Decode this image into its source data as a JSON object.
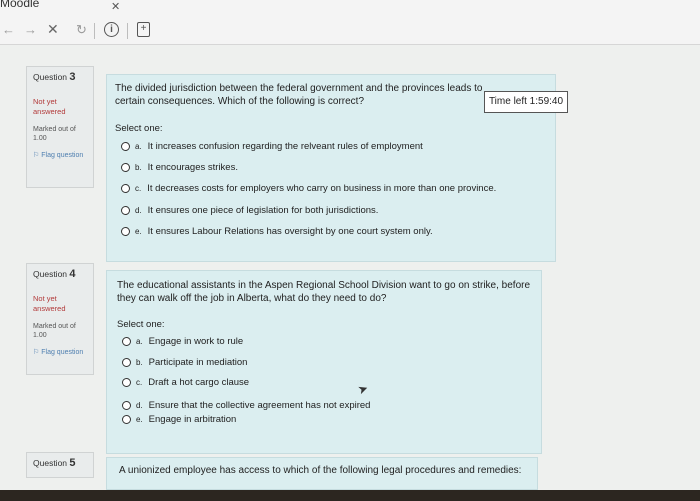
{
  "window": {
    "title": "Moodle",
    "close_glyph": "✕"
  },
  "toolbar": {
    "back_glyph": "←",
    "forward_glyph": "→",
    "stop_glyph": "✕",
    "reload_glyph": "↻",
    "info_glyph": "i",
    "page_glyph": "+"
  },
  "timer": {
    "label": "Time left 1:59:40"
  },
  "questions": [
    {
      "number_prefix": "Question",
      "number": "3",
      "state": "Not yet answered",
      "marks": "Marked out of 1.00",
      "flag": "Flag question",
      "text": "The divided jurisdiction between the federal government and the provinces leads to certain consequences. Which of the following is correct?",
      "select_label": "Select one:",
      "options": [
        {
          "letter": "a.",
          "text": "It increases confusion regarding the relveant rules of employment"
        },
        {
          "letter": "b.",
          "text": "It encourages strikes."
        },
        {
          "letter": "c.",
          "text": "It decreases costs for employers who carry on business in more than one province."
        },
        {
          "letter": "d.",
          "text": "It ensures one piece of legislation for both jurisdictions."
        },
        {
          "letter": "e.",
          "text": "It ensures Labour Relations has oversight by one court system only."
        }
      ]
    },
    {
      "number_prefix": "Question",
      "number": "4",
      "state": "Not yet answered",
      "marks": "Marked out of 1.00",
      "flag": "Flag question",
      "text": "The educational assistants in the Aspen Regional School Division want to go on strike, before they can walk off the job in Alberta, what do they need to do?",
      "select_label": "Select one:",
      "options": [
        {
          "letter": "a.",
          "text": "Engage in work to rule"
        },
        {
          "letter": "b.",
          "text": "Participate in mediation"
        },
        {
          "letter": "c.",
          "text": "Draft a hot cargo clause"
        },
        {
          "letter": "d.",
          "text": "Ensure that the collective agreement has not expired"
        },
        {
          "letter": "e.",
          "text": "Engage in arbitration"
        }
      ]
    },
    {
      "number_prefix": "Question",
      "number": "5",
      "text": "A unionized employee has access to which of the following legal procedures and remedies:"
    }
  ]
}
